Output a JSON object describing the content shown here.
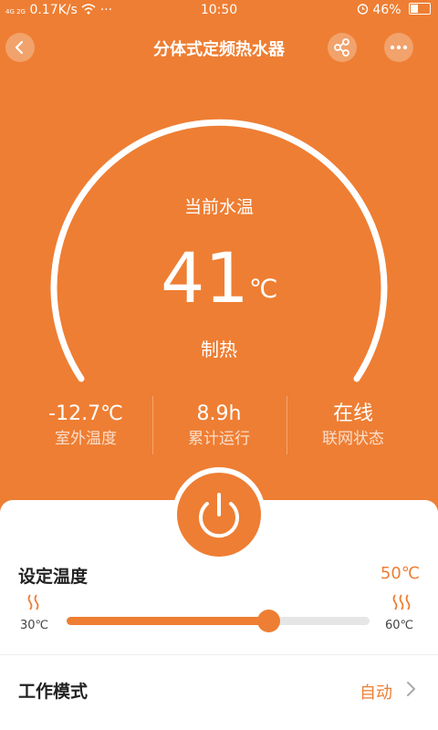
{
  "status_bar": {
    "network": "4G 2G",
    "speed": "0.17K/s",
    "dots": "···",
    "time": "10:50",
    "battery": "46%",
    "battery_level": 0.46
  },
  "header": {
    "title": "分体式定频热水器"
  },
  "icons": {
    "back": "chevron-left-icon",
    "share": "share-icon",
    "more": "more-icon",
    "power": "power-icon",
    "heat": "heat-wave-icon",
    "chevron": "chevron-right-icon"
  },
  "gauge": {
    "label": "当前水温",
    "value": "41",
    "unit": "℃",
    "mode": "制热"
  },
  "stats": [
    {
      "value": "-12.7℃",
      "label": "室外温度"
    },
    {
      "value": "8.9h",
      "label": "累计运行"
    },
    {
      "value": "在线",
      "label": "联网状态"
    }
  ],
  "set_temperature": {
    "label": "设定温度",
    "value": "50℃",
    "min_label": "30℃",
    "max_label": "60℃",
    "min": 30,
    "max": 60,
    "current": 50
  },
  "work_mode": {
    "label": "工作模式",
    "value": "自动"
  },
  "colors": {
    "accent": "#ee7e33",
    "white": "#ffffff",
    "track": "#e6e6e6"
  }
}
